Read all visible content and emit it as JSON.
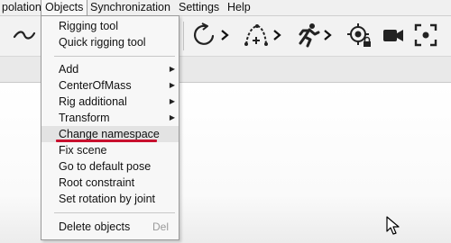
{
  "menubar": {
    "items": [
      {
        "label": "polation"
      },
      {
        "label": "Objects"
      },
      {
        "label": "Synchronization"
      },
      {
        "label": "Settings"
      },
      {
        "label": "Help"
      }
    ]
  },
  "toolbar": {
    "buttons": [
      {
        "icon": "curve-icon"
      },
      {
        "icon": "rotate-arrow-icon"
      },
      {
        "icon": "add-path-icon"
      },
      {
        "icon": "running-man-icon"
      },
      {
        "icon": "locked-target-icon"
      },
      {
        "icon": "camera-icon"
      },
      {
        "icon": "focus-frame-icon"
      }
    ]
  },
  "objects_menu": {
    "items": [
      {
        "label": "Rigging tool"
      },
      {
        "label": "Quick rigging tool"
      },
      {
        "label": "Add",
        "submenu": true
      },
      {
        "label": "CenterOfMass",
        "submenu": true
      },
      {
        "label": "Rig additional",
        "submenu": true
      },
      {
        "label": "Transform",
        "submenu": true
      },
      {
        "label": "Change namespace",
        "highlighted": true
      },
      {
        "label": "Fix scene"
      },
      {
        "label": "Go to default pose"
      },
      {
        "label": "Root constraint"
      },
      {
        "label": "Set rotation by joint"
      },
      {
        "label": "Delete objects",
        "shortcut": "Del"
      }
    ],
    "annotation_color": "#c8102e"
  }
}
